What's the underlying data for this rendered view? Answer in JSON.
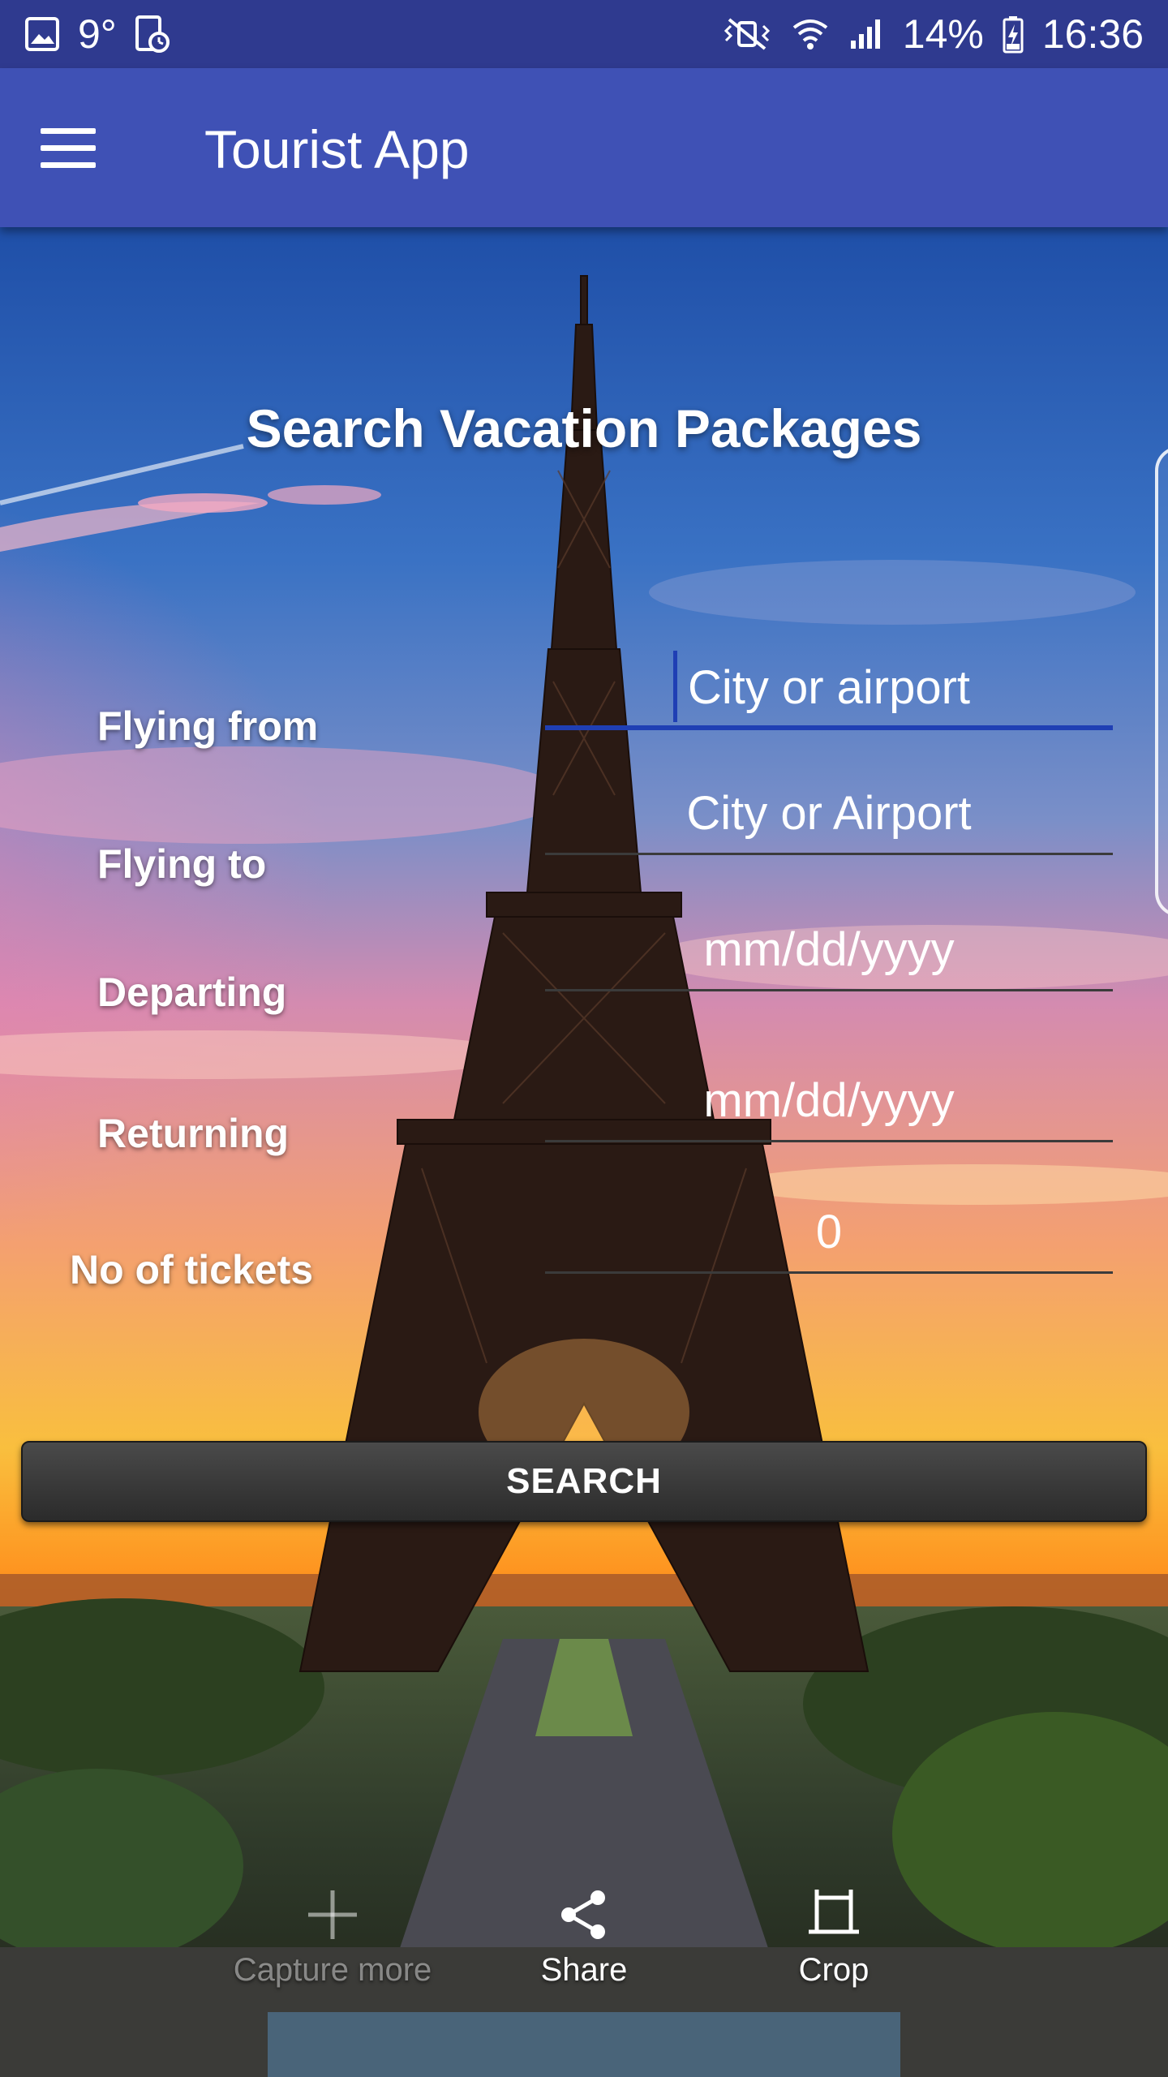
{
  "status_bar": {
    "temperature": "9°",
    "battery": "14%",
    "time": "16:36"
  },
  "app_bar": {
    "title": "Tourist App"
  },
  "form": {
    "heading": "Search Vacation Packages",
    "flying_from": {
      "label": "Flying from",
      "placeholder": "City or airport"
    },
    "flying_to": {
      "label": "Flying to",
      "placeholder": "City or Airport"
    },
    "departing": {
      "label": "Departing",
      "placeholder": "mm/dd/yyyy"
    },
    "returning": {
      "label": "Returning",
      "placeholder": "mm/dd/yyyy"
    },
    "tickets": {
      "label": "No of tickets",
      "value": "0"
    },
    "search_label": "SEARCH"
  },
  "capture_toolbar": {
    "capture_more": "Capture more",
    "share": "Share",
    "crop": "Crop"
  },
  "colors": {
    "status_bar": "#2f3a8f",
    "app_bar": "#3f51b5",
    "focus_underline": "#1f3fb4"
  }
}
